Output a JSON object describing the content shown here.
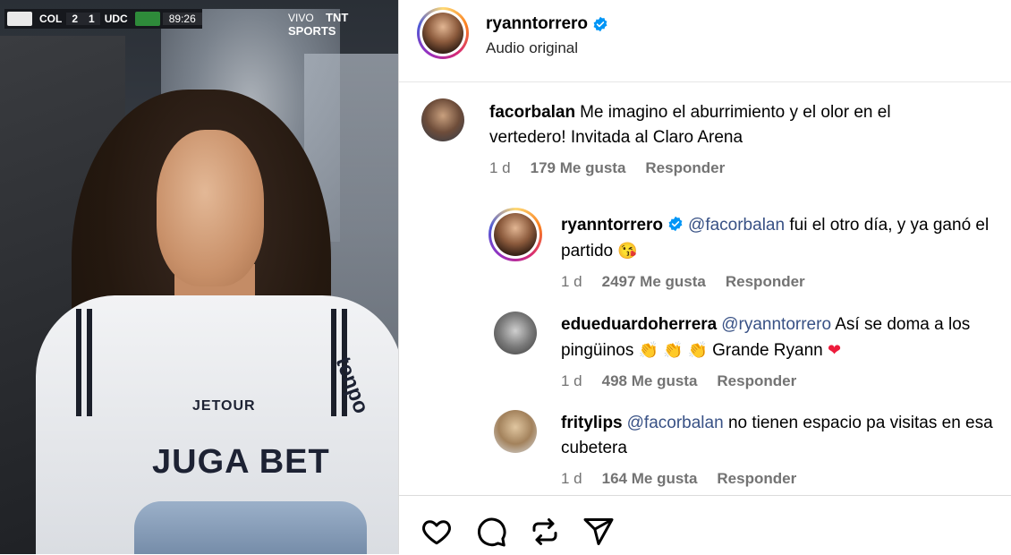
{
  "media": {
    "scoreboard": {
      "home_team": "COL",
      "home_score": "2",
      "away_score": "1",
      "away_team": "UDC",
      "clock": "89:26"
    },
    "live_label": "VIVO",
    "broadcaster": "TNT SPORTS",
    "shirt_sponsor": "JUGA BET",
    "shirt_sponsor_2": "JETOUR",
    "shirt_sponsor_3": "tenpo"
  },
  "header": {
    "username": "ryanntorrero",
    "subtitle": "Audio original"
  },
  "comments": [
    {
      "username": "facorbalan",
      "text": "Me imagino el aburrimiento y el olor en el vertedero! Invitada al Claro Arena",
      "time": "1 d",
      "likes": "179 Me gusta",
      "reply": "Responder"
    },
    {
      "username": "ryanntorrero",
      "mention": "@facorbalan",
      "text": "fui el otro día, y ya ganó el partido",
      "emoji": "😘",
      "time": "1 d",
      "likes": "2497 Me gusta",
      "reply": "Responder"
    },
    {
      "username": "edueduardoherrera",
      "mention": "@ryanntorrero",
      "text": "Así se doma a los pingüinos",
      "emoji_claps": "👏 👏 👏",
      "text_after": "Grande Ryann",
      "emoji_heart": "❤",
      "time": "1 d",
      "likes": "498 Me gusta",
      "reply": "Responder"
    },
    {
      "username": "fritylips",
      "mention": "@facorbalan",
      "text": "no tienen espacio pa visitas en esa cubetera",
      "time": "1 d",
      "likes": "164 Me gusta",
      "reply": "Responder"
    }
  ],
  "colors": {
    "verified_blue": "#0095f6",
    "mention_blue": "#385185",
    "meta_gray": "#737373"
  }
}
